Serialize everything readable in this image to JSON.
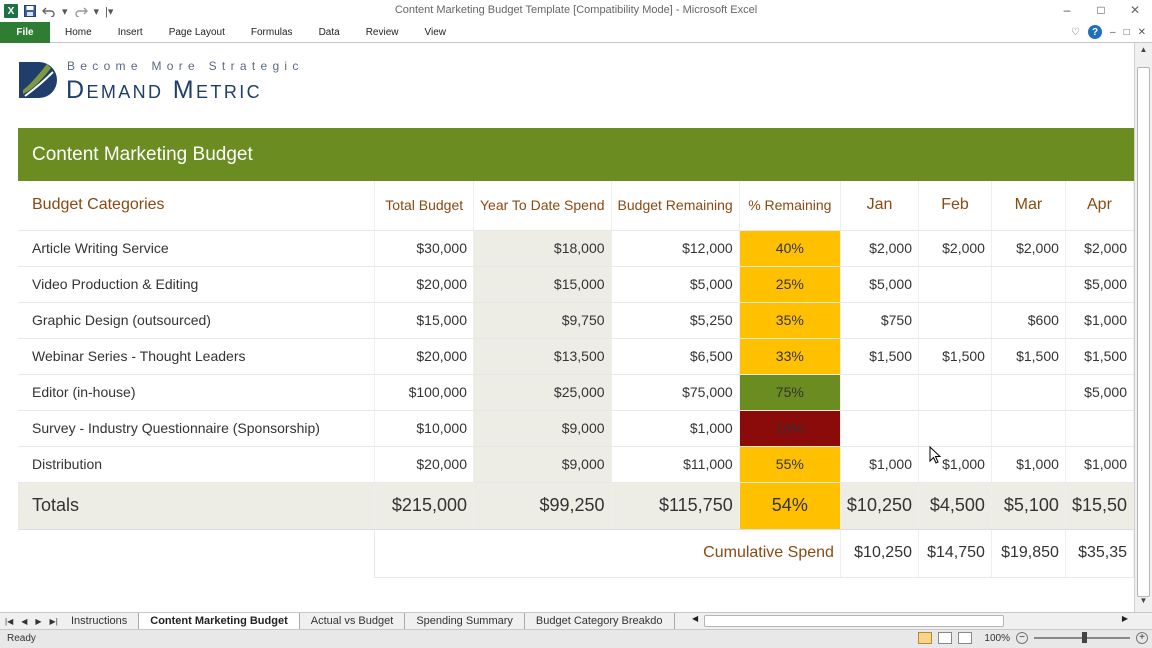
{
  "window": {
    "title": "Content Marketing Budget Template  [Compatibility Mode]  -  Microsoft Excel",
    "app_icon": "X",
    "controls": [
      "–",
      "□",
      "✕"
    ],
    "doc_controls": [
      "–",
      "□",
      "✕"
    ]
  },
  "ribbon": {
    "file": "File",
    "tabs": [
      "Home",
      "Insert",
      "Page Layout",
      "Formulas",
      "Data",
      "Review",
      "View"
    ]
  },
  "logo": {
    "tagline": "Become More Strategic",
    "brand": "Demand Metric"
  },
  "banner": {
    "title": "Content Marketing Budget"
  },
  "table": {
    "headers": {
      "category": "Budget Categories",
      "total": "Total Budget",
      "ytd": "Year To Date Spend",
      "remaining": "Budget Remaining",
      "pct": "% Remaining",
      "months": [
        "Jan",
        "Feb",
        "Mar",
        "Apr"
      ]
    },
    "rows": [
      {
        "category": "Article Writing Service",
        "total": "$30,000",
        "ytd": "$18,000",
        "remaining": "$12,000",
        "pct": "40%",
        "pct_color": "#ffc000",
        "months": [
          "$2,000",
          "$2,000",
          "$2,000",
          "$2,000"
        ]
      },
      {
        "category": "Video Production & Editing",
        "total": "$20,000",
        "ytd": "$15,000",
        "remaining": "$5,000",
        "pct": "25%",
        "pct_color": "#ffc000",
        "months": [
          "$5,000",
          "",
          "",
          "$5,000"
        ]
      },
      {
        "category": "Graphic Design (outsourced)",
        "total": "$15,000",
        "ytd": "$9,750",
        "remaining": "$5,250",
        "pct": "35%",
        "pct_color": "#ffc000",
        "months": [
          "$750",
          "",
          "$600",
          "$1,000"
        ]
      },
      {
        "category": "Webinar Series - Thought Leaders",
        "total": "$20,000",
        "ytd": "$13,500",
        "remaining": "$6,500",
        "pct": "33%",
        "pct_color": "#ffc000",
        "months": [
          "$1,500",
          "$1,500",
          "$1,500",
          "$1,500"
        ]
      },
      {
        "category": "Editor (in-house)",
        "total": "$100,000",
        "ytd": "$25,000",
        "remaining": "$75,000",
        "pct": "75%",
        "pct_color": "#6a8c21",
        "months": [
          "",
          "",
          "",
          "$5,000"
        ]
      },
      {
        "category": "Survey - Industry Questionnaire (Sponsorship)",
        "total": "$10,000",
        "ytd": "$9,000",
        "remaining": "$1,000",
        "pct": "10%",
        "pct_color": "#8b0a0a",
        "months": [
          "",
          "",
          "",
          ""
        ]
      },
      {
        "category": "Distribution",
        "total": "$20,000",
        "ytd": "$9,000",
        "remaining": "$11,000",
        "pct": "55%",
        "pct_color": "#ffc000",
        "months": [
          "$1,000",
          "$1,000",
          "$1,000",
          "$1,000"
        ]
      }
    ],
    "totals": {
      "label": "Totals",
      "total": "$215,000",
      "ytd": "$99,250",
      "remaining": "$115,750",
      "pct": "54%",
      "pct_color": "#ffc000",
      "months": [
        "$10,250",
        "$4,500",
        "$5,100",
        "$15,50"
      ]
    },
    "cumulative": {
      "label": "Cumulative Spend",
      "months": [
        "$10,250",
        "$14,750",
        "$19,850",
        "$35,35"
      ]
    }
  },
  "sheet_tabs": {
    "tabs": [
      "Instructions",
      "Content Marketing Budget",
      "Actual vs Budget",
      "Spending Summary",
      "Budget Category Breakdo"
    ],
    "active": 1
  },
  "status": {
    "ready": "Ready",
    "zoom": "100%"
  }
}
